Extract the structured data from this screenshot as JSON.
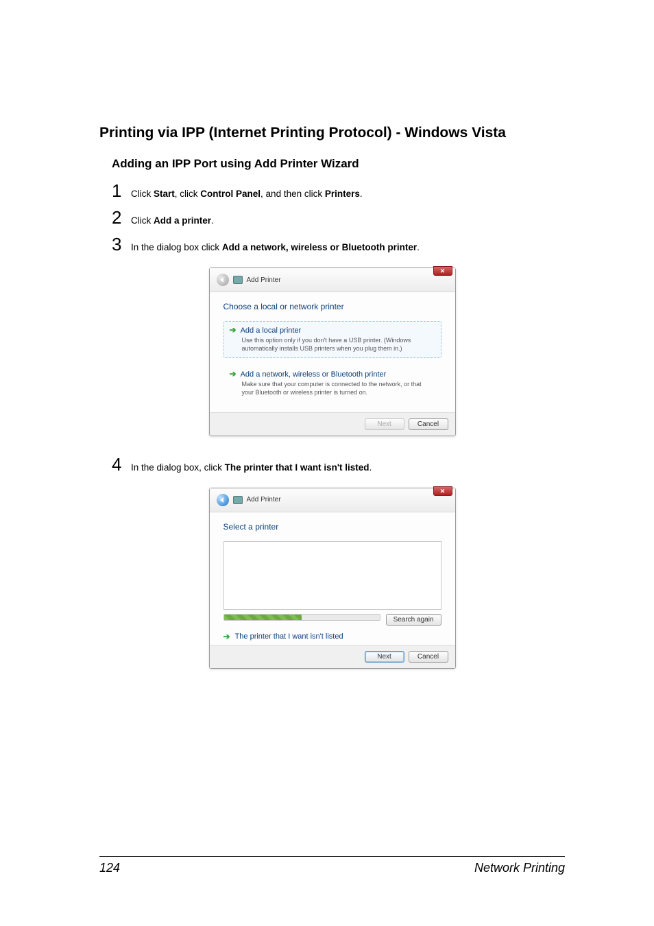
{
  "section": {
    "title": "Printing via IPP (Internet Printing Protocol) - Windows Vista",
    "subtitle": "Adding an IPP Port using Add Printer Wizard"
  },
  "steps": {
    "s1_a": "Click ",
    "s1_b": "Start",
    "s1_c": ", click ",
    "s1_d": "Control Panel",
    "s1_e": ", and then click ",
    "s1_f": "Printers",
    "s1_g": ".",
    "s2_a": "Click ",
    "s2_b": "Add a printer",
    "s2_c": ".",
    "s3_a": "In the dialog box click ",
    "s3_b": "Add a network, wireless or Bluetooth printer",
    "s3_c": ".",
    "s4_a": "In the dialog box, click ",
    "s4_b": "The printer that I want isn't listed",
    "s4_c": "."
  },
  "dlg1": {
    "title": "Add Printer",
    "heading": "Choose a local or network printer",
    "opt1_title": "Add a local printer",
    "opt1_desc": "Use this option only if you don't have a USB printer. (Windows automatically installs USB printers when you plug them in.)",
    "opt2_title": "Add a network, wireless or Bluetooth printer",
    "opt2_desc": "Make sure that your computer is connected to the network, or that your Bluetooth or wireless printer is turned on.",
    "next": "Next",
    "cancel": "Cancel"
  },
  "dlg2": {
    "title": "Add Printer",
    "heading": "Select a printer",
    "search_again": "Search again",
    "link": "The printer that I want isn't listed",
    "next": "Next",
    "cancel": "Cancel"
  },
  "footer": {
    "page": "124",
    "section": "Network Printing"
  },
  "glyph": {
    "x": "✕",
    "arrow": "➔"
  }
}
